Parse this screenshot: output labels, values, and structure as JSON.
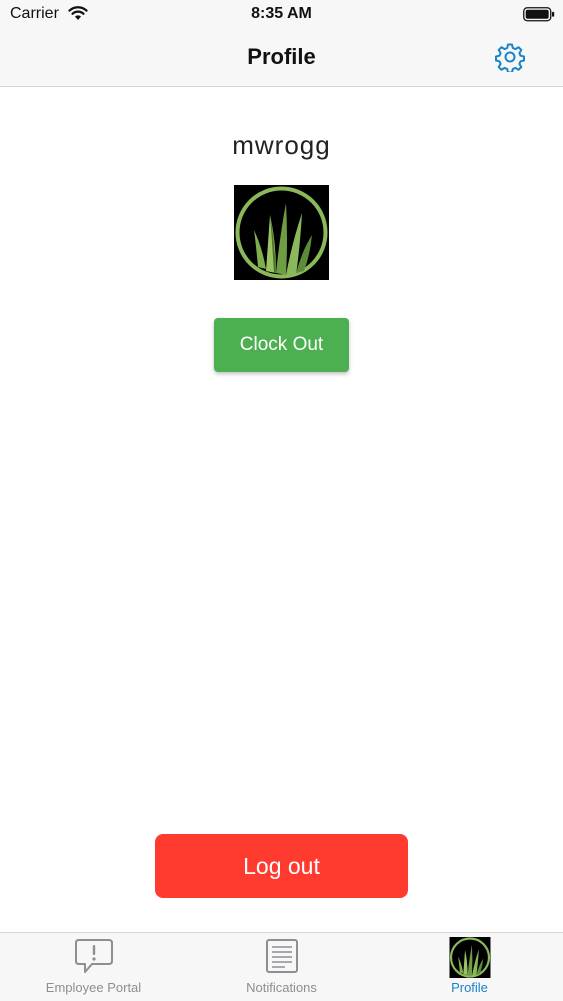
{
  "status_bar": {
    "carrier": "Carrier",
    "time": "8:35 AM",
    "wifi_icon": "wifi-icon",
    "battery_icon": "battery-icon"
  },
  "nav": {
    "title": "Profile",
    "settings_icon": "gear-icon",
    "accent_color": "#1a83c6"
  },
  "profile": {
    "username": "mwrogg",
    "avatar_icon": "grass-logo"
  },
  "actions": {
    "clock_label": "Clock Out",
    "clock_color": "#4caf50",
    "logout_label": "Log out",
    "logout_color": "#ff3b30"
  },
  "tabs": [
    {
      "label": "Employee Portal",
      "icon": "message-alert-icon",
      "active": false
    },
    {
      "label": "Notifications",
      "icon": "document-icon",
      "active": false
    },
    {
      "label": "Profile",
      "icon": "grass-logo",
      "active": true
    }
  ]
}
